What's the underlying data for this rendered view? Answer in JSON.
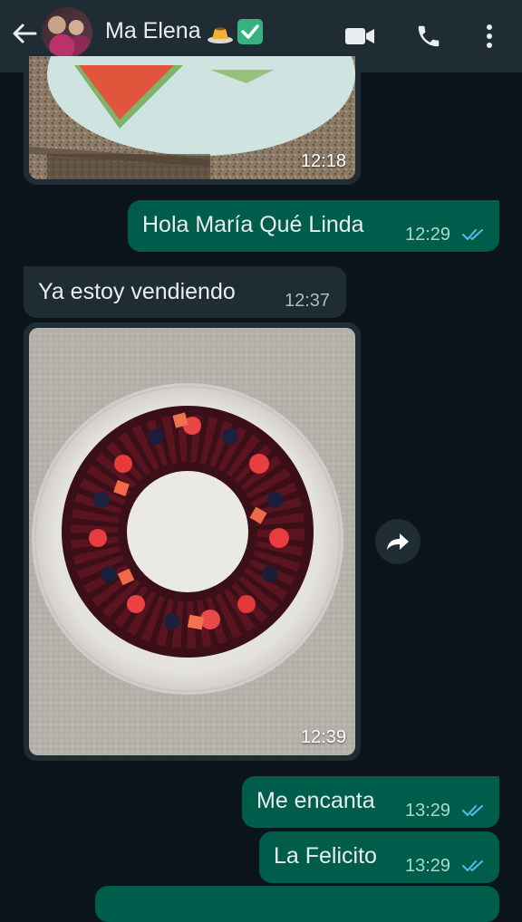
{
  "header": {
    "contact_name": "Ma Elena",
    "emoji_1": "flan-emoji",
    "emoji_2": "check-mark-button-emoji",
    "icons": [
      "back-arrow-icon",
      "video-call-icon",
      "phone-icon",
      "more-options-icon"
    ]
  },
  "messages": [
    {
      "type": "image",
      "direction": "incoming",
      "time": "12:18",
      "image": "watermelon-on-plate"
    },
    {
      "type": "text",
      "direction": "outgoing",
      "text": "Hola María Qué Linda",
      "time": "12:29",
      "status": "read"
    },
    {
      "type": "text",
      "direction": "incoming",
      "text": "Ya estoy vendiendo",
      "time": "12:37"
    },
    {
      "type": "image",
      "direction": "incoming",
      "time": "12:39",
      "image": "fruit-gelatin-ring"
    },
    {
      "type": "text",
      "direction": "outgoing",
      "text": "Me encanta",
      "time": "13:29",
      "status": "read"
    },
    {
      "type": "text",
      "direction": "outgoing",
      "text": "La Felicito",
      "time": "13:29",
      "status": "read"
    }
  ],
  "colors": {
    "background": "#0b141a",
    "header": "#1f2c34",
    "incoming_bubble": "#1f2c34",
    "outgoing_bubble": "#005c4b",
    "read_ticks": "#53bdeb"
  }
}
